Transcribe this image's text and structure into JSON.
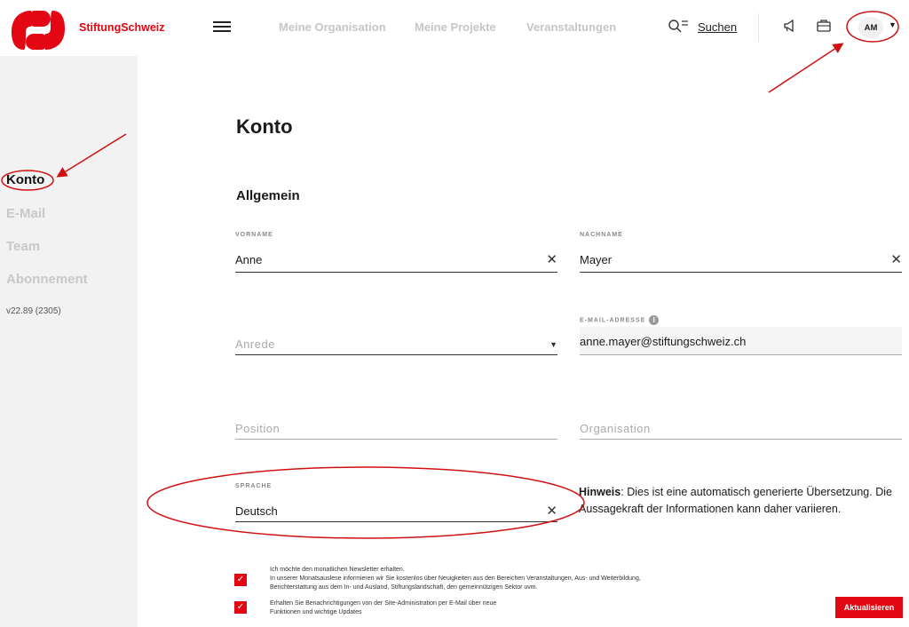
{
  "brand": {
    "name": "StiftungSchweiz"
  },
  "topnav": {
    "items": [
      "Meine Organisation",
      "Meine Projekte",
      "Veranstaltungen"
    ],
    "search_label": "Suchen"
  },
  "user": {
    "initials": "AM"
  },
  "sidebar": {
    "items": [
      {
        "label": "Konto",
        "active": true
      },
      {
        "label": "E-Mail",
        "active": false
      },
      {
        "label": "Team",
        "active": false
      },
      {
        "label": "Abonnement",
        "active": false
      }
    ],
    "version": "v22.89 (2305)"
  },
  "page": {
    "title": "Konto",
    "section_title": "Allgemein"
  },
  "form": {
    "vorname": {
      "label": "VORNAME",
      "value": "Anne"
    },
    "nachname": {
      "label": "NACHNAME",
      "value": "Mayer"
    },
    "anrede": {
      "placeholder": "Anrede"
    },
    "email": {
      "label": "E-MAIL-ADRESSE",
      "value": "anne.mayer@stiftungschweiz.ch"
    },
    "position": {
      "placeholder": "Position"
    },
    "organisation": {
      "placeholder": "Organisation"
    },
    "sprache": {
      "label": "SPRACHE",
      "value": "Deutsch"
    }
  },
  "hint": {
    "bold": "Hinweis",
    "text": ": Dies ist eine automatisch generierte Übersetzung. Die Aussagekraft der Informationen kann daher variieren."
  },
  "checkboxes": {
    "newsletter_title": "Ich möchte den monatlichen Newsletter erhalten.",
    "newsletter_desc": "In unserer Monatsauslese informieren wir Sie kostenlos über Neuigkeiten aus den Bereichen Veranstaltungen, Aus- und Weiterbildung, Berichterstattung aus dem In- und Ausland, Stiftungslandschaft, den gemeinnützigen Sektor uvm.",
    "notify_text": "Erhalten Sie Benachrichtigungen von der Site-Administration per E-Mail über neue Funktionen und wichtige Updates"
  },
  "buttons": {
    "update_label": "Aktualisieren"
  },
  "colors": {
    "brand_red": "#e30613",
    "annotation_red": "#d01010"
  }
}
